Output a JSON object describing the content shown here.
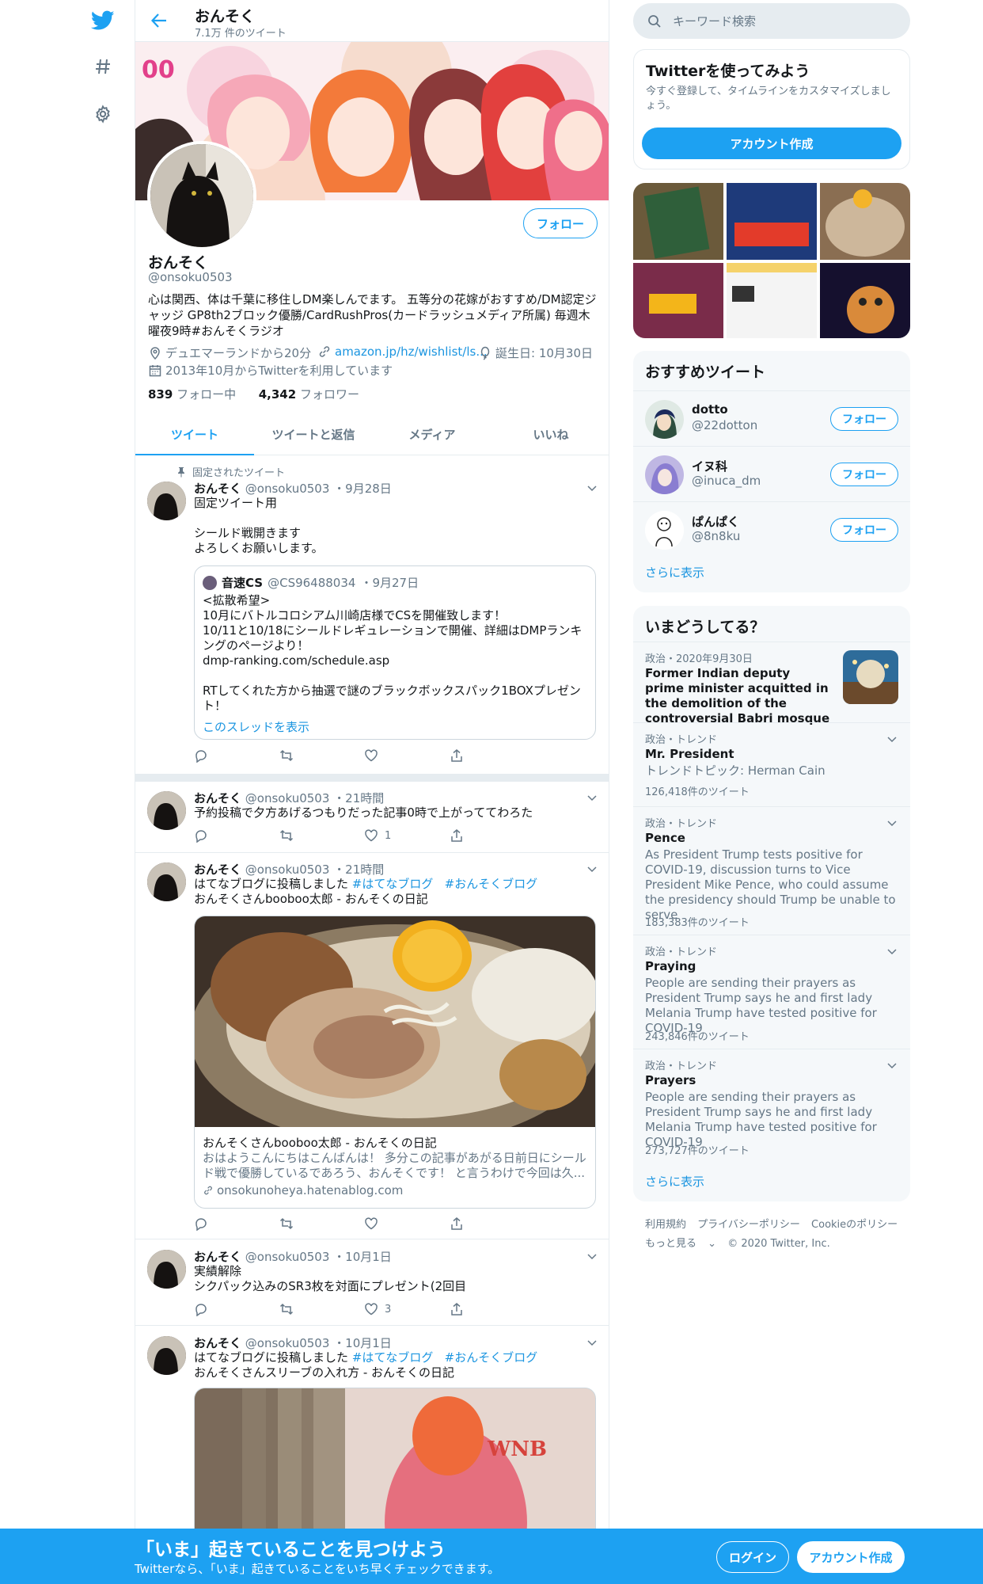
{
  "header": {
    "title": "おんそく",
    "subtitle": "7.1万 件のツイート"
  },
  "profile": {
    "name": "おんそく",
    "handle": "@onsoku0503",
    "follow_label": "フォロー",
    "bio": "心は関西、体は千葉に移住しDM楽しんでます。 五等分の花嫁がおすすめ/DM認定ジャッジ GP8th2ブロック優勝/CardRushPros(カードラッシュメディア所属) 毎週木曜夜9時#おんそくラジオ",
    "location": "デュエマーランドから20分",
    "url": "amazon.jp/hz/wishlist/ls...",
    "birthday": "誕生日: 10月30日",
    "joined": "2013年10月からTwitterを利用しています",
    "following_count": "839",
    "following_label": "フォロー中",
    "followers_count": "4,342",
    "followers_label": "フォロワー"
  },
  "tabs": [
    "ツイート",
    "ツイートと返信",
    "メディア",
    "いいね"
  ],
  "tweets": [
    {
      "pinned_label": "固定されたツイート",
      "name": "おんそく",
      "handle": "@onsoku0503",
      "date": "・9月28日",
      "text": "固定ツイート用\n\nシールド戦開きます\nよろしくお願いします。",
      "quote": {
        "name": "音速CS",
        "handle": "@CS96488034",
        "date": "・9月27日",
        "text": "<拡散希望>\n10月にバトルコロシアム川崎店様でCSを開催致します！\n10/11と10/18にシールドレギュレーションで開催、詳細はDMPランキングのページより！\ndmp-ranking.com/schedule.asp\n\nRTしてくれた方から抽選で謎のブラックボックスパック1BOXプレゼント！",
        "thread_link": "このスレッドを表示"
      },
      "likes": ""
    },
    {
      "name": "おんそく",
      "handle": "@onsoku0503",
      "date": "・21時間",
      "text": "予約投稿で夕方あげるつもりだった記事0時で上がっててわろた",
      "likes": "1"
    },
    {
      "name": "おんそく",
      "handle": "@onsoku0503",
      "date": "・21時間",
      "text_prefix": "はてなブログに投稿しました ",
      "hashtags": [
        "#はてなブログ",
        "#おんそくブログ"
      ],
      "text_line2": "おんそくさんbooboo太郎 - おんそくの日記",
      "card": {
        "title": "おんそくさんbooboo太郎 - おんそくの日記",
        "desc": "おはようこんにちはこんばんは！ 多分この記事があがる日前日にシールド戦で優勝しているであろう、おんそくです！ と言うわけで今回は久...",
        "url": "onsokunoheya.hatenablog.com"
      },
      "likes": ""
    },
    {
      "name": "おんそく",
      "handle": "@onsoku0503",
      "date": "・10月1日",
      "text": "実績解除\nシクパック込みのSR3枚を対面にプレゼント(2回目",
      "likes": "3"
    },
    {
      "name": "おんそく",
      "handle": "@onsoku0503",
      "date": "・10月1日",
      "text_prefix": "はてなブログに投稿しました ",
      "hashtags": [
        "#はてなブログ",
        "#おんそくブログ"
      ],
      "text_line2": "おんそくさんスリーブの入れ方 - おんそくの日記",
      "likes": ""
    }
  ],
  "search": {
    "placeholder": "キーワード検索"
  },
  "signup_panel": {
    "title": "Twitterを使ってみよう",
    "text": "今すぐ登録して、タイムラインをカスタマイズしましょう。",
    "button": "アカウント作成"
  },
  "who_to_follow": {
    "title": "おすすめツイート",
    "users": [
      {
        "name": "dotto",
        "handle": "@22dotton",
        "button": "フォロー"
      },
      {
        "name": "イヌ科",
        "handle": "@inuca_dm",
        "button": "フォロー"
      },
      {
        "name": "ぱんぱく",
        "handle": "@8n8ku",
        "button": "フォロー"
      }
    ],
    "more": "さらに表示"
  },
  "trends": {
    "title": "いまどうしてる？",
    "news": {
      "category": "政治・2020年9月30日",
      "title": "Former Indian deputy prime minister acquitted in the demolition of the controversial Babri mosque"
    },
    "items": [
      {
        "category": "政治・トレンド",
        "title": "Mr. President",
        "desc": "トレンドトピック: Herman Cain",
        "count": "126,418件のツイート"
      },
      {
        "category": "政治・トレンド",
        "title": "Pence",
        "desc": "As President Trump tests positive for COVID-19, discussion turns to Vice President Mike Pence, who could assume the presidency should Trump be unable to serve",
        "count": "183,383件のツイート"
      },
      {
        "category": "政治・トレンド",
        "title": "Praying",
        "desc": "People are sending their prayers as President Trump says he and first lady Melania Trump have tested positive for COVID-19",
        "count": "243,846件のツイート"
      },
      {
        "category": "政治・トレンド",
        "title": "Prayers",
        "desc": "People are sending their prayers as President Trump says he and first lady Melania Trump have tested positive for COVID-19",
        "count": "273,727件のツイート"
      }
    ],
    "more": "さらに表示"
  },
  "footer": {
    "links": [
      "利用規約",
      "プライバシーポリシー",
      "Cookieのポリシー"
    ],
    "more": "もっと見る",
    "copyright": "© 2020 Twitter, Inc."
  },
  "bottom_bar": {
    "title": "「いま」起きていることを見つけよう",
    "subtitle": "Twitterなら、「いま」起きていることをいち早くチェックできます。",
    "login": "ログイン",
    "signup": "アカウント作成"
  },
  "colors": {
    "accent": "#1da1f2",
    "link": "#1b95e0",
    "muted": "#657786",
    "border": "#e6ecf0"
  }
}
